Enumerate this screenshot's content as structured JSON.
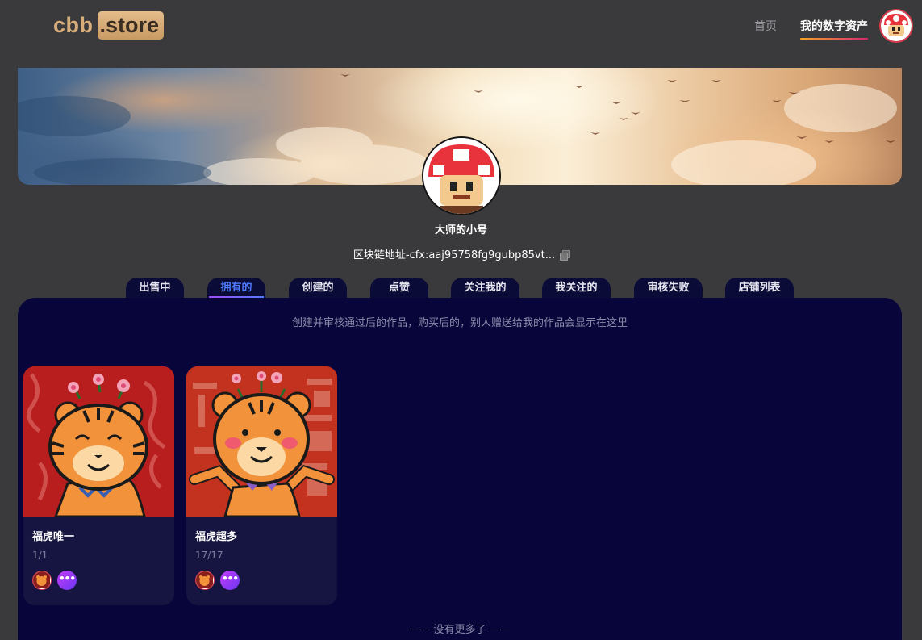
{
  "header": {
    "logo_left": "cbb",
    "logo_right": ".store",
    "nav": [
      {
        "label": "首页",
        "active": false
      },
      {
        "label": "我的数字资产",
        "active": true
      }
    ]
  },
  "profile": {
    "username": "大师的小号",
    "address": "区块链地址-cfx:aaj95758fg9gubp85vt..."
  },
  "tabs": [
    {
      "label": "出售中",
      "active": false
    },
    {
      "label": "拥有的",
      "active": true
    },
    {
      "label": "创建的",
      "active": false
    },
    {
      "label": "点赞",
      "active": false
    },
    {
      "label": "关注我的",
      "active": false
    },
    {
      "label": "我关注的",
      "active": false
    },
    {
      "label": "审核失败",
      "active": false
    },
    {
      "label": "店铺列表",
      "active": false
    }
  ],
  "panel": {
    "hint": "创建并审核通过后的作品，购买后的，别人赠送给我的作品会显示在这里",
    "end_text": "—— 没有更多了 ——"
  },
  "cards": [
    {
      "title": "福虎唯一",
      "count": "1/1",
      "more_icon": "ellipsis-icon"
    },
    {
      "title": "福虎超多",
      "count": "17/17",
      "more_icon": "ellipsis-icon"
    }
  ],
  "colors": {
    "page_bg": "#3a3a3c",
    "panel_bg": "#07053a",
    "card_bg": "#161542",
    "active_tab": "#4f7cff",
    "logo_gold": "#d8ad7a"
  }
}
